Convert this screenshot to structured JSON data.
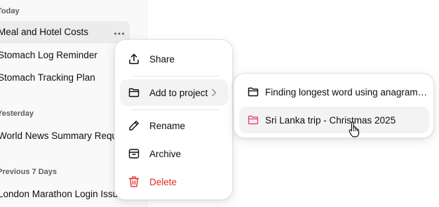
{
  "sidebar": {
    "sections": [
      {
        "label": "Today",
        "items": [
          {
            "title": "Meal and Hotel Costs",
            "active": true
          },
          {
            "title": "Stomach Log Reminder"
          },
          {
            "title": "Stomach Tracking Plan"
          }
        ]
      },
      {
        "label": "Yesterday",
        "items": [
          {
            "title": "World News Summary Request"
          }
        ]
      },
      {
        "label": "Previous 7 Days",
        "items": [
          {
            "title": "London Marathon Login Issue"
          }
        ]
      }
    ]
  },
  "context_menu": {
    "share": {
      "label": "Share",
      "icon": "share-icon"
    },
    "add_to_project": {
      "label": "Add to project",
      "icon": "folder-icon",
      "chevron": "chevron-right-icon"
    },
    "rename": {
      "label": "Rename",
      "icon": "pencil-icon"
    },
    "archive": {
      "label": "Archive",
      "icon": "archive-icon"
    },
    "delete": {
      "label": "Delete",
      "icon": "trash-icon",
      "color": "#e02e2a"
    }
  },
  "project_submenu": {
    "items": [
      {
        "label": "Finding longest word using anagrams i...",
        "icon": "folder-icon",
        "icon_color": "#0d0d0d"
      },
      {
        "label": "Sri Lanka trip - Christmas 2025",
        "icon": "folder-icon",
        "icon_color": "#e8467c",
        "hovered": true
      }
    ]
  },
  "colors": {
    "sidebar_bg": "#f9f9f9",
    "danger": "#e02e2a",
    "project_pink": "#e8467c"
  }
}
